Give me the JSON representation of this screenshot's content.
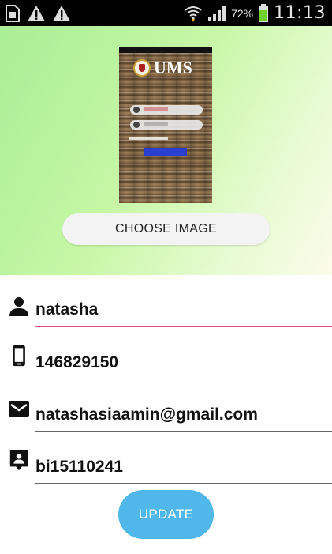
{
  "status_bar": {
    "battery_percent": "72%",
    "time": "11:13",
    "icons": [
      "sim-card-icon",
      "warning-icon",
      "warning-icon",
      "wifi-icon",
      "signal-icon",
      "battery-icon"
    ]
  },
  "header": {
    "preview": {
      "logo_text": "UMS"
    },
    "choose_image_label": "CHOOSE IMAGE"
  },
  "form": {
    "name": {
      "icon": "person-icon",
      "value": "natasha"
    },
    "phone": {
      "icon": "phone-icon",
      "value": "146829150"
    },
    "email": {
      "icon": "email-icon",
      "value": "natashasiaamin@gmail.com"
    },
    "id": {
      "icon": "id-badge-icon",
      "value": "bi15110241"
    }
  },
  "update_label": "UPDATE",
  "colors": {
    "accent_underline": "#e0487f",
    "update_button": "#4fb7ea",
    "header_gradient_start": "#a9ee95"
  }
}
